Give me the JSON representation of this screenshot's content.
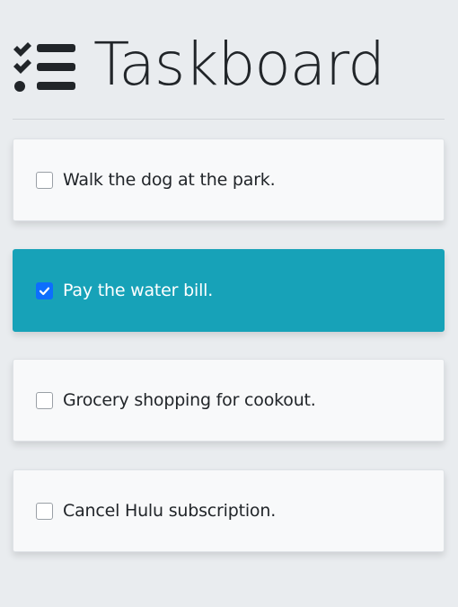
{
  "app": {
    "title": "Taskboard",
    "logo_icon": "tasks-list-icon"
  },
  "tasks": [
    {
      "label": "Walk the dog at the park.",
      "completed": false
    },
    {
      "label": "Pay the water bill.",
      "completed": true
    },
    {
      "label": "Grocery shopping for cookout.",
      "completed": false
    },
    {
      "label": "Cancel Hulu subscription.",
      "completed": false
    }
  ],
  "colors": {
    "background": "#e9ecef",
    "card": "#f8f9fa",
    "completed_card": "#17a2b8",
    "checkbox_checked": "#0d6efd",
    "text": "#212529"
  }
}
